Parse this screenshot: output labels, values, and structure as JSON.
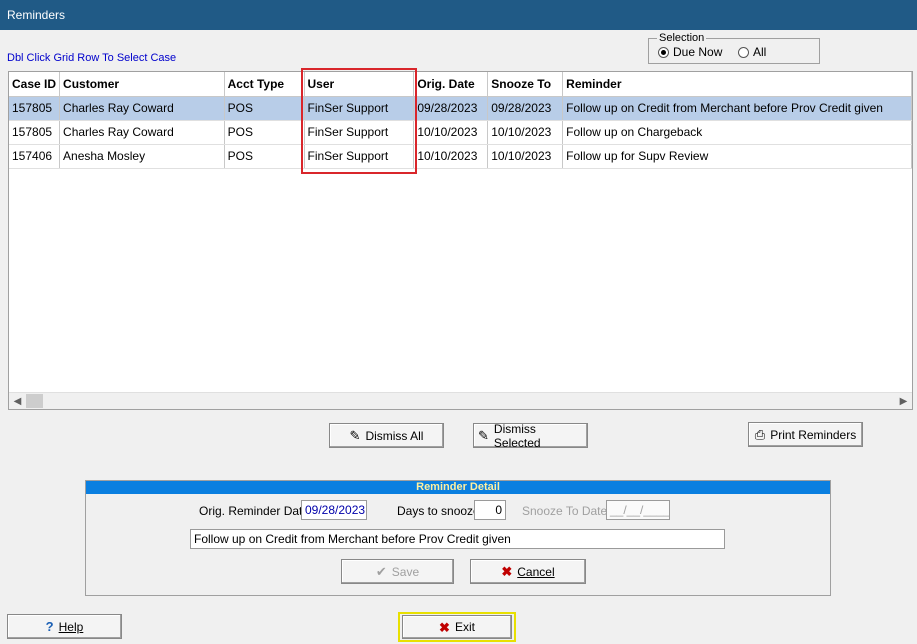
{
  "window": {
    "title": "Reminders"
  },
  "hint": "Dbl Click Grid Row To Select Case",
  "selection": {
    "legend": "Selection",
    "options": [
      {
        "label": "Due Now",
        "checked": true
      },
      {
        "label": "All",
        "checked": false
      }
    ]
  },
  "grid": {
    "columns": [
      "Case ID",
      "Customer",
      "Acct Type",
      "User",
      "Orig. Date",
      "Snooze To",
      "Reminder"
    ],
    "rows": [
      [
        "157805",
        "Charles Ray Coward",
        "POS",
        "FinSer Support",
        "09/28/2023",
        "09/28/2023",
        "Follow up on Credit from Merchant before Prov Credit given"
      ],
      [
        "157805",
        "Charles Ray Coward",
        "POS",
        "FinSer Support",
        "10/10/2023",
        "10/10/2023",
        "Follow up on Chargeback"
      ],
      [
        "157406",
        "Anesha Mosley",
        "POS",
        "FinSer Support",
        "10/10/2023",
        "10/10/2023",
        "Follow up for Supv Review"
      ]
    ],
    "selected_row": 0
  },
  "actions": {
    "dismiss_all": "Dismiss All",
    "dismiss_selected": "Dismiss Selected",
    "print_reminders": "Print Reminders"
  },
  "detail": {
    "header": "Reminder Detail",
    "orig_date_label": "Orig. Reminder Date",
    "orig_date_value": "09/28/2023",
    "days_label": "Days to snooze",
    "days_value": "0",
    "snooze_label": "Snooze To Date",
    "snooze_value": "__/__/____",
    "text_value": "Follow up on Credit from Merchant before Prov Credit given",
    "save_label": "Save",
    "cancel_label": "Cancel"
  },
  "footer": {
    "help_label": "Help",
    "exit_label": "Exit"
  },
  "colors": {
    "titlebar": "#205a86",
    "detail_header": "#0a7fe0",
    "highlight": "#d9262b",
    "exit_focus": "#e8e000"
  }
}
